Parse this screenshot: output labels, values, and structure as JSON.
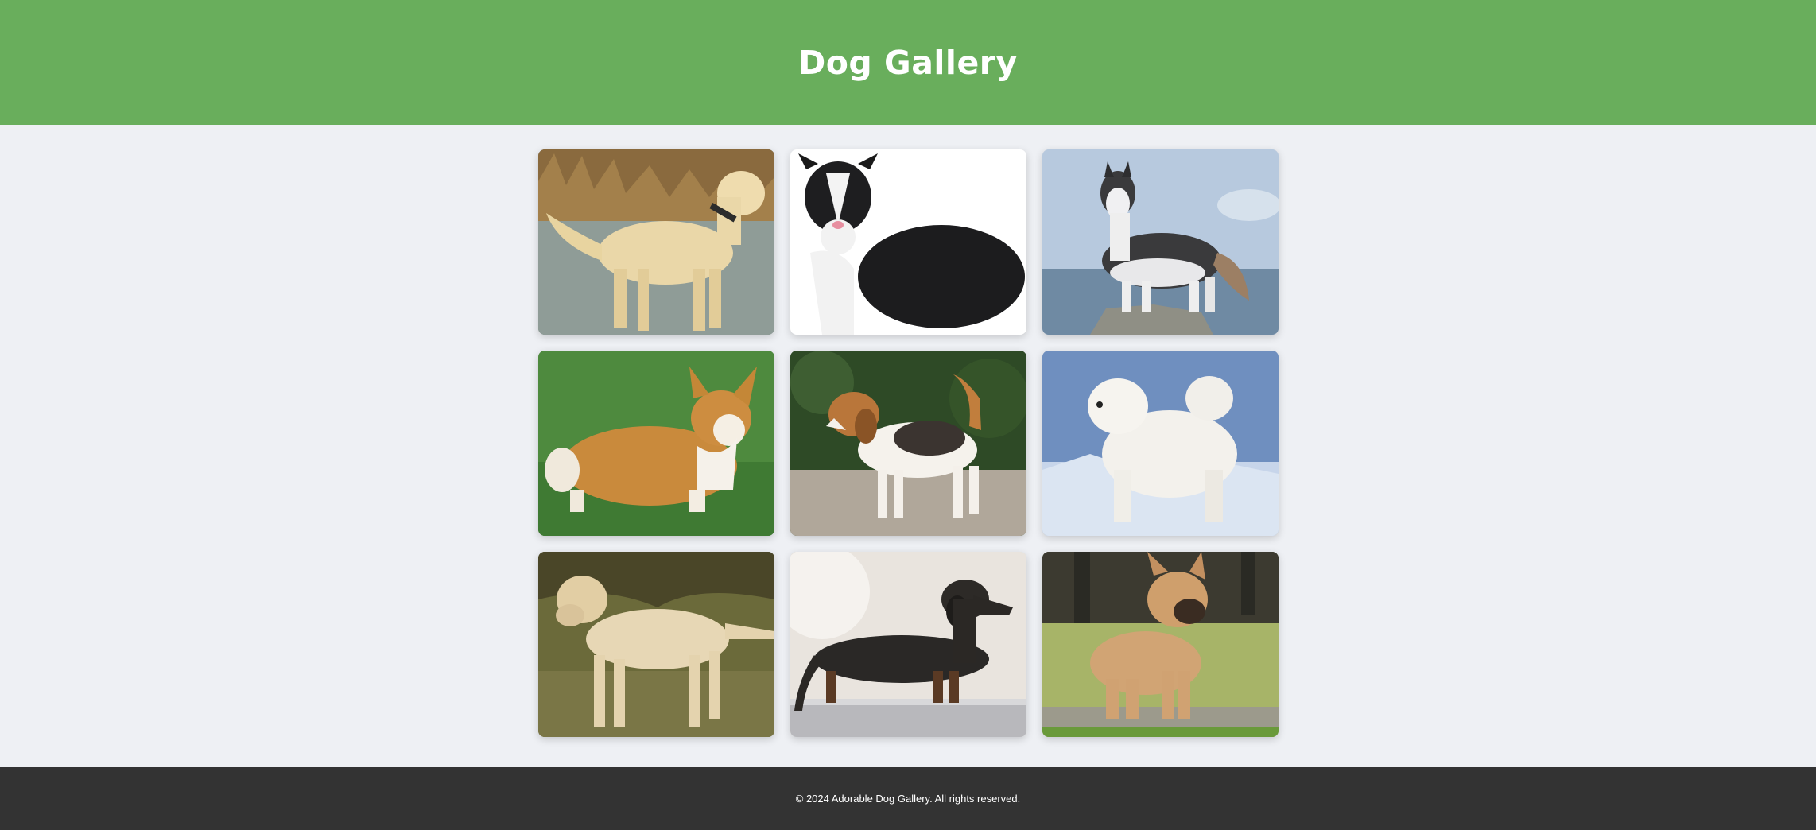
{
  "header": {
    "title": "Dog Gallery",
    "bg_color": "#69ae5c"
  },
  "gallery": {
    "items": [
      {
        "breed": "golden-retriever"
      },
      {
        "breed": "border-collie"
      },
      {
        "breed": "siberian-husky"
      },
      {
        "breed": "corgi"
      },
      {
        "breed": "beagle"
      },
      {
        "breed": "samoyed"
      },
      {
        "breed": "labrador"
      },
      {
        "breed": "dachshund"
      },
      {
        "breed": "french-bulldog"
      }
    ]
  },
  "footer": {
    "copyright": "© 2024 Adorable Dog Gallery. All rights reserved.",
    "bg_color": "#333333"
  }
}
